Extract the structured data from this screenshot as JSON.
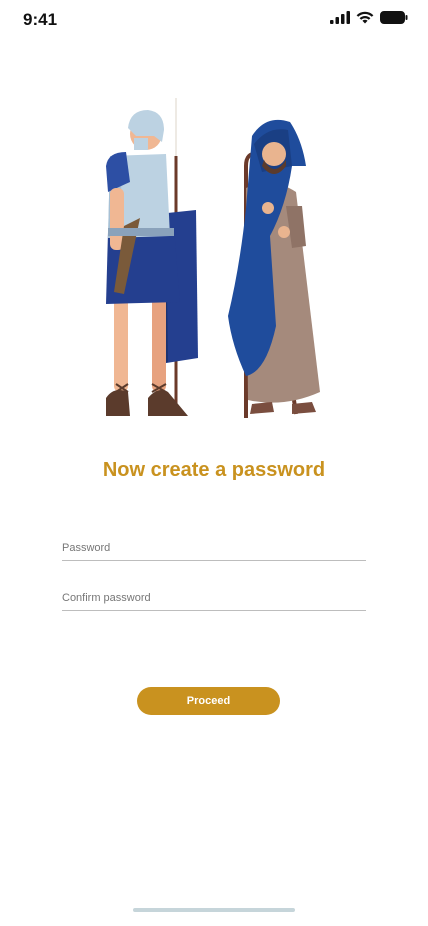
{
  "status_bar": {
    "time": "9:41",
    "icons": [
      "signal-icon",
      "wifi-icon",
      "battery-icon"
    ]
  },
  "illustration": {
    "description": "soldier-and-shepherd"
  },
  "screen": {
    "title": "Now create a password"
  },
  "form": {
    "password_placeholder": "Password",
    "confirm_placeholder": "Confirm password",
    "password_value": "",
    "confirm_value": ""
  },
  "actions": {
    "proceed_label": "Proceed"
  },
  "colors": {
    "accent": "#c9921f",
    "divider": "#bdbdbd",
    "home_indicator": "#c6d5da"
  }
}
